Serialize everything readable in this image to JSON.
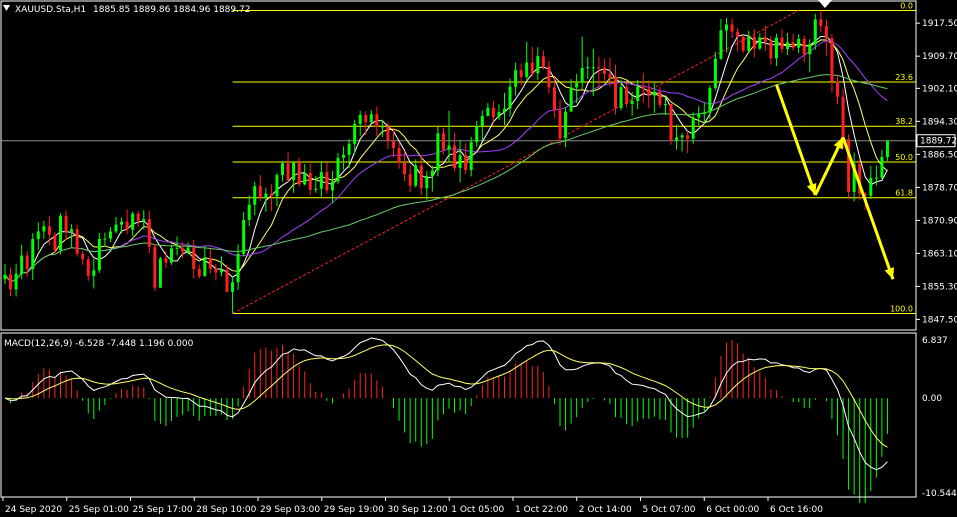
{
  "chart_data": {
    "type": "candlestick",
    "title": "XAUUSD.Sta,H1",
    "ohlc_label": "1885.85 1889.86 1884.96 1889.72",
    "last_price": "1889.72",
    "price_axis": {
      "ylim": [
        1845.0,
        1922.5
      ],
      "ticks": [
        "1917.50",
        "1909.70",
        "1902.10",
        "1894.30",
        "1886.50",
        "1878.70",
        "1870.90",
        "1863.10",
        "1855.30",
        "1847.50"
      ]
    },
    "time_axis": {
      "labels": [
        "24 Sep 2020",
        "25 Sep 01:00",
        "25 Sep 17:00",
        "28 Sep 10:00",
        "29 Sep 03:00",
        "29 Sep 19:00",
        "30 Sep 12:00",
        "1 Oct 05:00",
        "1 Oct 22:00",
        "2 Oct 14:00",
        "5 Oct 07:00",
        "6 Oct 00:00",
        "6 Oct 16:00"
      ]
    },
    "fibonacci": {
      "high": 1920.5,
      "low": 1848.9,
      "levels": [
        {
          "label": "0.0",
          "ratio": 0.0
        },
        {
          "label": "23.6",
          "ratio": 0.236
        },
        {
          "label": "38.2",
          "ratio": 0.382
        },
        {
          "label": "50.0",
          "ratio": 0.5
        },
        {
          "label": "61.8",
          "ratio": 0.618
        },
        {
          "label": "100.0",
          "ratio": 1.0
        }
      ]
    },
    "candles": [
      [
        1857.0,
        1860.6,
        1855.8,
        1858.1
      ],
      [
        1858.1,
        1859.8,
        1853.0,
        1854.6
      ],
      [
        1854.6,
        1860.7,
        1852.9,
        1858.3
      ],
      [
        1858.3,
        1865.1,
        1857.0,
        1862.6
      ],
      [
        1862.6,
        1863.6,
        1857.6,
        1859.4
      ],
      [
        1859.4,
        1867.9,
        1856.8,
        1866.5
      ],
      [
        1866.5,
        1870.4,
        1863.9,
        1868.3
      ],
      [
        1868.3,
        1870.8,
        1866.5,
        1869.5
      ],
      [
        1869.5,
        1871.8,
        1865.0,
        1867.5
      ],
      [
        1867.5,
        1868.1,
        1863.3,
        1863.9
      ],
      [
        1863.9,
        1872.6,
        1862.9,
        1872.0
      ],
      [
        1872.0,
        1873.3,
        1866.3,
        1868.2
      ],
      [
        1868.2,
        1870.0,
        1864.4,
        1868.8
      ],
      [
        1868.8,
        1869.9,
        1862.3,
        1863.0
      ],
      [
        1863.0,
        1863.7,
        1860.4,
        1861.7
      ],
      [
        1861.7,
        1862.4,
        1856.6,
        1857.8
      ],
      [
        1857.8,
        1861.8,
        1854.8,
        1859.1
      ],
      [
        1859.1,
        1867.9,
        1858.5,
        1866.5
      ],
      [
        1866.5,
        1868.0,
        1864.7,
        1866.6
      ],
      [
        1866.6,
        1869.3,
        1865.8,
        1868.3
      ],
      [
        1868.3,
        1871.7,
        1867.8,
        1869.9
      ],
      [
        1869.9,
        1871.6,
        1867.9,
        1870.6
      ],
      [
        1870.6,
        1873.5,
        1867.6,
        1868.7
      ],
      [
        1868.7,
        1873.0,
        1867.2,
        1872.5
      ],
      [
        1872.5,
        1873.1,
        1869.4,
        1870.8
      ],
      [
        1870.8,
        1873.3,
        1868.8,
        1871.2
      ],
      [
        1871.2,
        1873.2,
        1863.2,
        1864.7
      ],
      [
        1864.7,
        1865.2,
        1854.2,
        1855.0
      ],
      [
        1855.0,
        1862.3,
        1854.9,
        1861.9
      ],
      [
        1861.9,
        1863.6,
        1859.6,
        1860.9
      ],
      [
        1860.9,
        1865.1,
        1860.4,
        1864.3
      ],
      [
        1864.3,
        1867.1,
        1862.6,
        1864.4
      ],
      [
        1864.4,
        1865.7,
        1862.0,
        1863.5
      ],
      [
        1863.5,
        1865.7,
        1862.8,
        1864.5
      ],
      [
        1864.5,
        1866.3,
        1857.2,
        1859.4
      ],
      [
        1859.4,
        1860.4,
        1857.1,
        1857.7
      ],
      [
        1857.7,
        1864.8,
        1857.7,
        1862.0
      ],
      [
        1862.0,
        1864.2,
        1858.4,
        1859.5
      ],
      [
        1859.5,
        1860.6,
        1856.7,
        1858.6
      ],
      [
        1858.6,
        1862.4,
        1857.7,
        1859.2
      ],
      [
        1859.2,
        1860.3,
        1853.9,
        1854.0
      ],
      [
        1854.0,
        1857.7,
        1848.9,
        1856.3
      ],
      [
        1856.3,
        1865.2,
        1854.5,
        1863.0
      ],
      [
        1863.0,
        1872.9,
        1862.4,
        1871.0
      ],
      [
        1871.0,
        1876.8,
        1869.5,
        1874.6
      ],
      [
        1874.6,
        1880.0,
        1872.1,
        1879.0
      ],
      [
        1879.0,
        1881.6,
        1875.5,
        1876.2
      ],
      [
        1876.2,
        1878.6,
        1872.9,
        1877.2
      ],
      [
        1877.2,
        1879.4,
        1873.1,
        1876.6
      ],
      [
        1876.6,
        1882.1,
        1874.3,
        1881.6
      ],
      [
        1881.6,
        1885.0,
        1880.1,
        1884.4
      ],
      [
        1884.4,
        1887.0,
        1879.9,
        1880.4
      ],
      [
        1880.4,
        1884.9,
        1877.4,
        1884.5
      ],
      [
        1884.5,
        1885.7,
        1878.8,
        1879.4
      ],
      [
        1879.4,
        1884.2,
        1879.2,
        1882.1
      ],
      [
        1882.1,
        1884.3,
        1876.9,
        1878.1
      ],
      [
        1878.1,
        1881.4,
        1877.4,
        1878.4
      ],
      [
        1878.4,
        1884.6,
        1876.5,
        1882.3
      ],
      [
        1882.3,
        1884.5,
        1877.2,
        1878.0
      ],
      [
        1878.0,
        1882.6,
        1874.9,
        1880.1
      ],
      [
        1880.1,
        1886.8,
        1879.5,
        1885.7
      ],
      [
        1885.7,
        1888.4,
        1882.9,
        1886.4
      ],
      [
        1886.4,
        1890.1,
        1883.2,
        1889.0
      ],
      [
        1889.0,
        1894.7,
        1886.7,
        1893.7
      ],
      [
        1893.7,
        1896.8,
        1890.9,
        1895.8
      ],
      [
        1895.8,
        1896.7,
        1891.1,
        1894.1
      ],
      [
        1894.1,
        1896.9,
        1893.8,
        1896.0
      ],
      [
        1896.0,
        1897.8,
        1890.9,
        1893.0
      ],
      [
        1893.0,
        1894.7,
        1890.6,
        1893.1
      ],
      [
        1893.1,
        1894.0,
        1887.7,
        1889.6
      ],
      [
        1889.6,
        1892.7,
        1885.8,
        1888.0
      ],
      [
        1888.0,
        1889.5,
        1883.1,
        1884.5
      ],
      [
        1884.5,
        1887.3,
        1880.2,
        1881.8
      ],
      [
        1881.8,
        1883.9,
        1877.6,
        1879.1
      ],
      [
        1879.1,
        1885.3,
        1878.7,
        1883.9
      ],
      [
        1883.9,
        1886.3,
        1876.9,
        1878.5
      ],
      [
        1878.5,
        1882.5,
        1875.8,
        1881.4
      ],
      [
        1881.4,
        1883.8,
        1877.7,
        1882.7
      ],
      [
        1882.7,
        1893.0,
        1881.3,
        1891.5
      ],
      [
        1891.5,
        1892.8,
        1886.4,
        1887.6
      ],
      [
        1887.6,
        1896.8,
        1884.6,
        1888.6
      ],
      [
        1888.6,
        1891.6,
        1882.5,
        1883.3
      ],
      [
        1883.3,
        1889.8,
        1879.9,
        1886.3
      ],
      [
        1886.3,
        1889.1,
        1881.8,
        1882.8
      ],
      [
        1882.8,
        1890.6,
        1881.3,
        1889.4
      ],
      [
        1889.4,
        1894.4,
        1888.2,
        1893.2
      ],
      [
        1893.2,
        1896.9,
        1889.8,
        1895.6
      ],
      [
        1895.6,
        1898.6,
        1895.4,
        1897.5
      ],
      [
        1897.5,
        1899.2,
        1894.2,
        1895.3
      ],
      [
        1895.3,
        1898.3,
        1894.6,
        1896.5
      ],
      [
        1896.5,
        1901.0,
        1893.4,
        1897.3
      ],
      [
        1897.3,
        1904.4,
        1895.4,
        1902.5
      ],
      [
        1902.5,
        1908.2,
        1900.4,
        1906.4
      ],
      [
        1906.4,
        1908.0,
        1902.8,
        1904.8
      ],
      [
        1904.8,
        1913.1,
        1904.2,
        1908.2
      ],
      [
        1908.2,
        1911.9,
        1904.9,
        1905.7
      ],
      [
        1905.7,
        1911.8,
        1904.1,
        1909.7
      ],
      [
        1909.7,
        1911.1,
        1906.5,
        1907.3
      ],
      [
        1907.3,
        1908.6,
        1900.9,
        1902.3
      ],
      [
        1902.3,
        1904.8,
        1895.1,
        1896.9
      ],
      [
        1896.9,
        1899.4,
        1888.6,
        1890.4
      ],
      [
        1890.4,
        1897.6,
        1888.2,
        1896.6
      ],
      [
        1896.6,
        1904.3,
        1896.6,
        1902.3
      ],
      [
        1902.3,
        1905.5,
        1898.6,
        1903.4
      ],
      [
        1903.4,
        1914.3,
        1901.9,
        1906.9
      ],
      [
        1906.9,
        1909.5,
        1904.3,
        1907.1
      ],
      [
        1907.1,
        1911.4,
        1900.3,
        1907.1
      ],
      [
        1907.1,
        1909.6,
        1902.5,
        1907.0
      ],
      [
        1907.0,
        1909.1,
        1903.8,
        1905.5
      ],
      [
        1905.5,
        1909.3,
        1902.5,
        1904.7
      ],
      [
        1904.7,
        1907.7,
        1895.9,
        1897.5
      ],
      [
        1897.5,
        1904.2,
        1896.9,
        1902.4
      ],
      [
        1902.4,
        1903.3,
        1897.6,
        1898.4
      ],
      [
        1898.4,
        1901.2,
        1895.6,
        1899.1
      ],
      [
        1899.1,
        1904.1,
        1897.2,
        1902.4
      ],
      [
        1902.4,
        1905.7,
        1898.7,
        1902.0
      ],
      [
        1902.0,
        1904.0,
        1897.4,
        1900.4
      ],
      [
        1900.4,
        1903.4,
        1896.3,
        1901.3
      ],
      [
        1901.3,
        1902.5,
        1897.5,
        1898.2
      ],
      [
        1898.2,
        1900.1,
        1895.8,
        1898.4
      ],
      [
        1898.4,
        1898.5,
        1888.8,
        1889.8
      ],
      [
        1889.8,
        1893.5,
        1887.6,
        1890.5
      ],
      [
        1890.5,
        1891.6,
        1887.2,
        1891.0
      ],
      [
        1891.0,
        1892.0,
        1886.8,
        1890.2
      ],
      [
        1890.2,
        1896.4,
        1889.0,
        1895.2
      ],
      [
        1895.2,
        1897.9,
        1893.4,
        1896.0
      ],
      [
        1896.0,
        1898.8,
        1893.8,
        1896.4
      ],
      [
        1896.4,
        1902.8,
        1894.9,
        1902.2
      ],
      [
        1902.2,
        1910.7,
        1901.6,
        1909.1
      ],
      [
        1909.1,
        1918.5,
        1908.8,
        1915.8
      ],
      [
        1915.8,
        1918.7,
        1910.6,
        1917.2
      ],
      [
        1917.2,
        1918.6,
        1914.0,
        1915.5
      ],
      [
        1915.5,
        1916.4,
        1910.8,
        1914.3
      ],
      [
        1914.3,
        1914.9,
        1910.4,
        1911.0
      ],
      [
        1911.0,
        1915.7,
        1910.5,
        1914.3
      ],
      [
        1914.3,
        1916.1,
        1909.4,
        1911.5
      ],
      [
        1911.5,
        1915.1,
        1911.1,
        1914.1
      ],
      [
        1914.1,
        1916.8,
        1910.9,
        1913.1
      ],
      [
        1913.1,
        1914.4,
        1907.7,
        1909.2
      ],
      [
        1909.2,
        1915.0,
        1907.4,
        1914.1
      ],
      [
        1914.1,
        1916.2,
        1910.5,
        1911.4
      ],
      [
        1911.4,
        1915.2,
        1910.0,
        1913.0
      ],
      [
        1913.0,
        1915.0,
        1911.0,
        1911.7
      ],
      [
        1911.7,
        1914.9,
        1910.4,
        1913.8
      ],
      [
        1913.8,
        1914.6,
        1908.3,
        1910.2
      ],
      [
        1910.2,
        1913.7,
        1905.9,
        1912.5
      ],
      [
        1912.5,
        1919.7,
        1911.2,
        1918.4
      ],
      [
        1918.4,
        1920.5,
        1915.4,
        1916.8
      ],
      [
        1916.8,
        1918.4,
        1909.8,
        1913.9
      ],
      [
        1913.9,
        1914.9,
        1901.1,
        1903.7
      ],
      [
        1903.7,
        1904.9,
        1898.3,
        1900.1
      ],
      [
        1900.1,
        1901.9,
        1887.9,
        1890.1
      ],
      [
        1890.1,
        1891.2,
        1875.9,
        1877.6
      ],
      [
        1877.6,
        1886.9,
        1875.4,
        1884.2
      ],
      [
        1884.2,
        1885.4,
        1875.7,
        1877.2
      ],
      [
        1877.2,
        1877.6,
        1873.4,
        1876.7
      ],
      [
        1876.7,
        1883.8,
        1876.0,
        1880.9
      ],
      [
        1880.9,
        1883.9,
        1879.1,
        1881.0
      ],
      [
        1881.0,
        1887.6,
        1880.7,
        1885.9
      ],
      [
        1885.85,
        1889.86,
        1884.96,
        1889.72
      ]
    ],
    "indicators": {
      "moving_averages": [
        {
          "color": "#ffffff",
          "period": 5
        },
        {
          "color": "#ffff66",
          "period": 9
        },
        {
          "color": "#a040ff",
          "period": 21
        },
        {
          "color": "#66cc66",
          "period": 55
        }
      ],
      "macd": {
        "label": "MACD(12,26,9) -6.528 -7.448 1.196 0.000",
        "ylim": [
          -10.544,
          6.837
        ],
        "ticks": [
          "6.837",
          "0.00",
          "-10.544"
        ],
        "fast": 12,
        "slow": 26,
        "signal": 9
      }
    },
    "trendline": {
      "from": [
        41,
        1848.9
      ],
      "to": [
        143,
        1920.5
      ]
    },
    "projection": {
      "points": [
        [
          146,
          1876.9
        ],
        [
          151,
          1890.5
        ],
        [
          160,
          1857.0
        ]
      ]
    },
    "colors": {
      "bull": "#00ff00",
      "bear": "#ff2020",
      "fib": "#ffff00",
      "trend": "#ff2020",
      "axis": "#ffffff",
      "grid": "#ffffff",
      "arrow": "#ffff00"
    }
  }
}
